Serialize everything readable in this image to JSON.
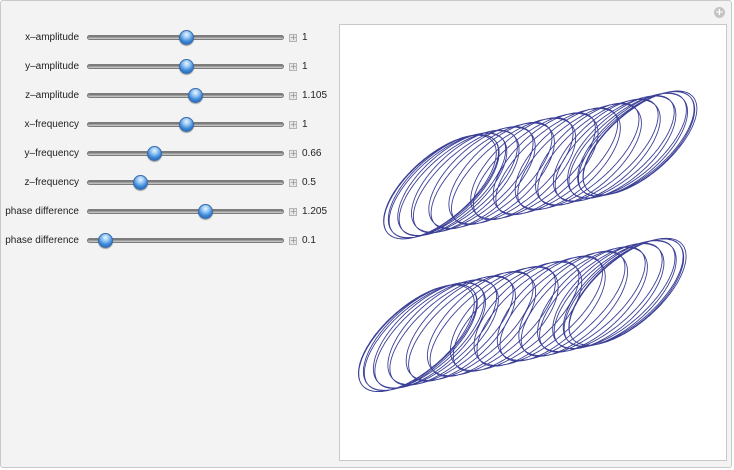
{
  "controls": [
    {
      "label": "x–amplitude",
      "value": "1",
      "fraction": 0.5
    },
    {
      "label": "y–amplitude",
      "value": "1",
      "fraction": 0.5
    },
    {
      "label": "z–amplitude",
      "value": "1.105",
      "fraction": 0.55
    },
    {
      "label": "x–frequency",
      "value": "1",
      "fraction": 0.5
    },
    {
      "label": "y–frequency",
      "value": "0.66",
      "fraction": 0.34
    },
    {
      "label": "z–frequency",
      "value": "0.5",
      "fraction": 0.27
    },
    {
      "label": "phase difference",
      "value": "1.205",
      "fraction": 0.6
    },
    {
      "label": "phase difference",
      "value": "0.1",
      "fraction": 0.09
    }
  ],
  "plot": {
    "line_color": "#3b3f96",
    "frequencies": {
      "x": 1,
      "y": 0.66,
      "z": 0.5
    },
    "amplitudes": {
      "x": 1,
      "y": 1,
      "z": 1.105
    },
    "phases": [
      1.205,
      0.1
    ]
  },
  "icons": {
    "add": "plus-circle-icon",
    "slider_expand": "plus-box-icon"
  }
}
